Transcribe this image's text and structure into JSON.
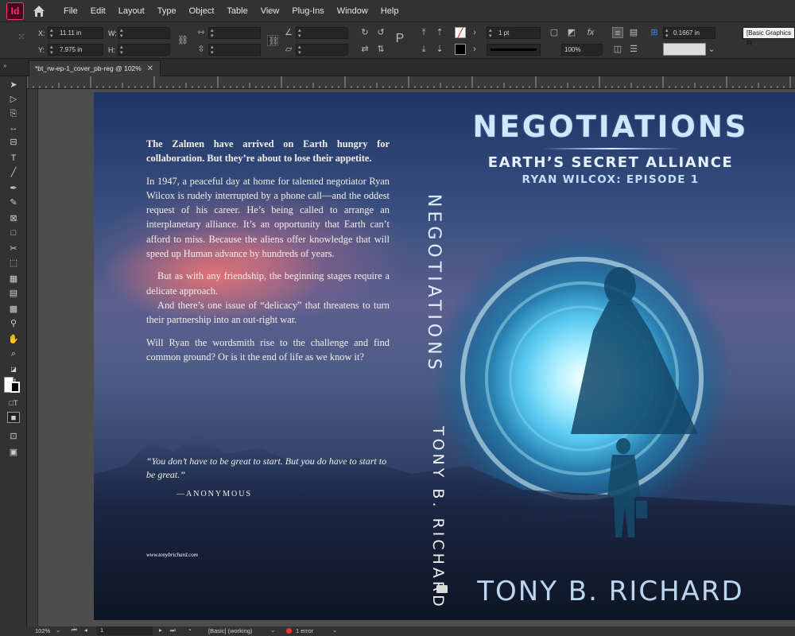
{
  "app": {
    "logo_text": "Id"
  },
  "menu": [
    "File",
    "Edit",
    "Layout",
    "Type",
    "Object",
    "Table",
    "View",
    "Plug-Ins",
    "Window",
    "Help"
  ],
  "control": {
    "x_label": "X:",
    "x_value": "11.11 in",
    "y_label": "Y:",
    "y_value": "7.975 in",
    "w_label": "W:",
    "h_label": "H:",
    "stroke_weight": "1 pt",
    "opacity": "100%",
    "offset": "0.1667 in",
    "object_style": "[Basic Graphics Fr"
  },
  "document_tab": {
    "label": "*bt_rw-ep-1_cover_pb-reg @ 102%"
  },
  "status": {
    "zoom": "102%",
    "page": "1",
    "style": "[Basic] (working)",
    "errors": "1 error"
  },
  "cover": {
    "back": {
      "lead": "The Zalmen have arrived on Earth hungry for collaboration. But they’re about to lose their appetite.",
      "para1": "In 1947, a peaceful day at home for talented negotiator Ryan Wilcox is rudely interrupted by a phone call—and the oddest request of his career. He’s being called to arrange an interplanetary alliance. It’s an opportunity that Earth can’t afford to miss. Because the aliens offer knowledge that will speed up Human advance by hundreds of years.",
      "para2": "But as with any friendship, the beginning stages require a delicate approach.",
      "para3": "And there’s one issue of “delicacy” that threatens to turn their partnership into an out-right war.",
      "para4": "Will Ryan the wordsmith rise to the challenge and find common ground? Or is it the end of life as we know it?",
      "quote": "“You don’t have to be great to start. But you do have to start to be great.”",
      "attribution": "—ANONYMOUS",
      "url": "www.tonybrichard.com"
    },
    "spine": {
      "title": "NEGOTIATIONS",
      "author": "TONY B. RICHARD"
    },
    "front": {
      "title": "NEGOTIATIONS",
      "subtitle": "EARTH’S SECRET ALLIANCE",
      "series": "RYAN WILCOX: EPISODE 1",
      "author": "TONY B. RICHARD"
    }
  },
  "colors": {
    "accent": "#ff3366",
    "ui_dark": "#323232",
    "portal": "#7fe6ff"
  }
}
